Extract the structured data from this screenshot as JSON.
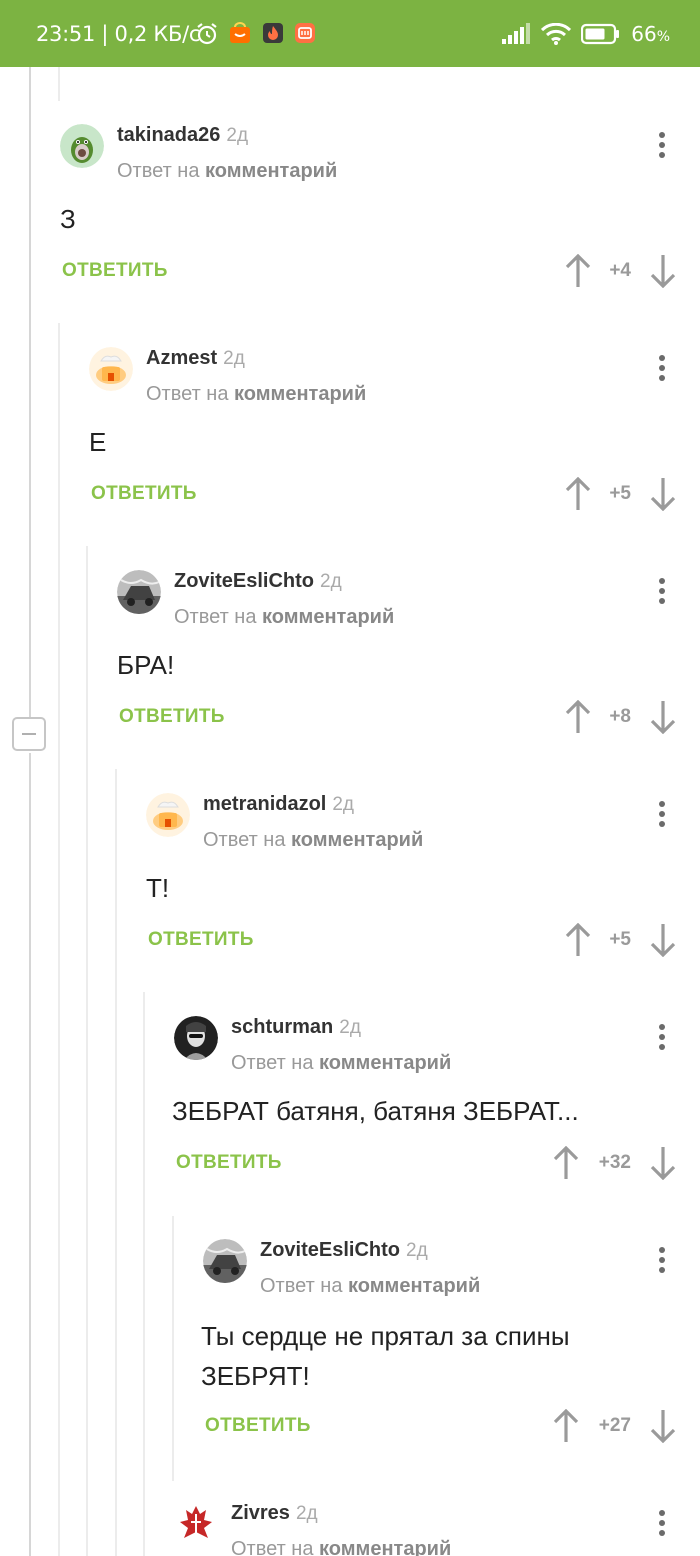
{
  "status_bar": {
    "time": "23:51 | 0,2 КБ/с",
    "battery_percent": "66",
    "battery_unit": "%"
  },
  "ui": {
    "reply_prefix": "Ответ на",
    "reply_target": "комментарий",
    "reply_button": "ОТВЕТИТЬ"
  },
  "comments": [
    {
      "username": "takinada26",
      "age": "2д",
      "text": "З",
      "rating": "+4"
    },
    {
      "username": "Azmest",
      "age": "2д",
      "text": "Е",
      "rating": "+5"
    },
    {
      "username": "ZoviteEsliChto",
      "age": "2д",
      "text": "БРА!",
      "rating": "+8"
    },
    {
      "username": "metranidazol",
      "age": "2д",
      "text": "Т!",
      "rating": "+5"
    },
    {
      "username": "schturman",
      "age": "2д",
      "text": "ЗЕБРАТ батяня, батяня ЗЕБРАТ...",
      "rating": "+32"
    },
    {
      "username": "ZoviteEsliChto",
      "age": "2д",
      "text_line1": "Ты сердце не прятал за спины",
      "text_line2": "ЗЕБРЯТ!",
      "rating": "+27"
    },
    {
      "username": "Zivres",
      "age": "2д"
    }
  ],
  "colors": {
    "accent": "#7cb342",
    "reply": "#8bc34a"
  }
}
